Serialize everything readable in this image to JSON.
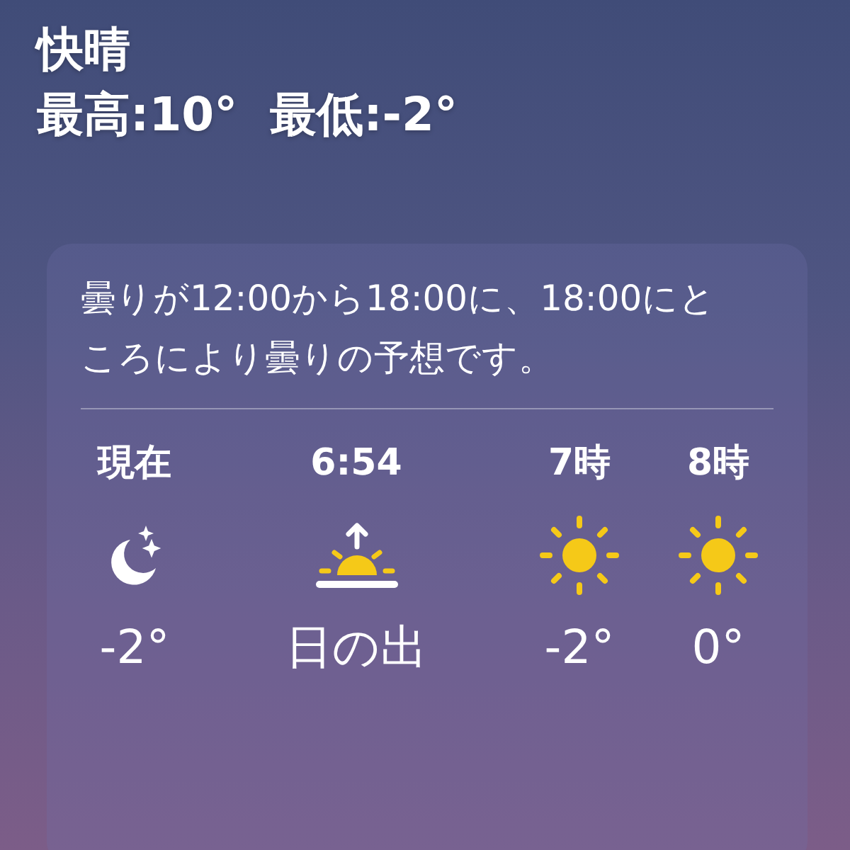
{
  "condition": "快晴",
  "high_low": "最高:10°  最低:-2°",
  "forecast": {
    "summary": "曇りが12:00から18:00に、18:00にところにより曇りの予想です。",
    "hours": [
      {
        "label": "現在",
        "kind": "moon",
        "temp": "-2°"
      },
      {
        "label": "6:54",
        "kind": "sunrise",
        "temp": "日の出"
      },
      {
        "label": "7時",
        "kind": "sun",
        "temp": "-2°"
      },
      {
        "label": "8時",
        "kind": "sun",
        "temp": "0°"
      }
    ]
  }
}
